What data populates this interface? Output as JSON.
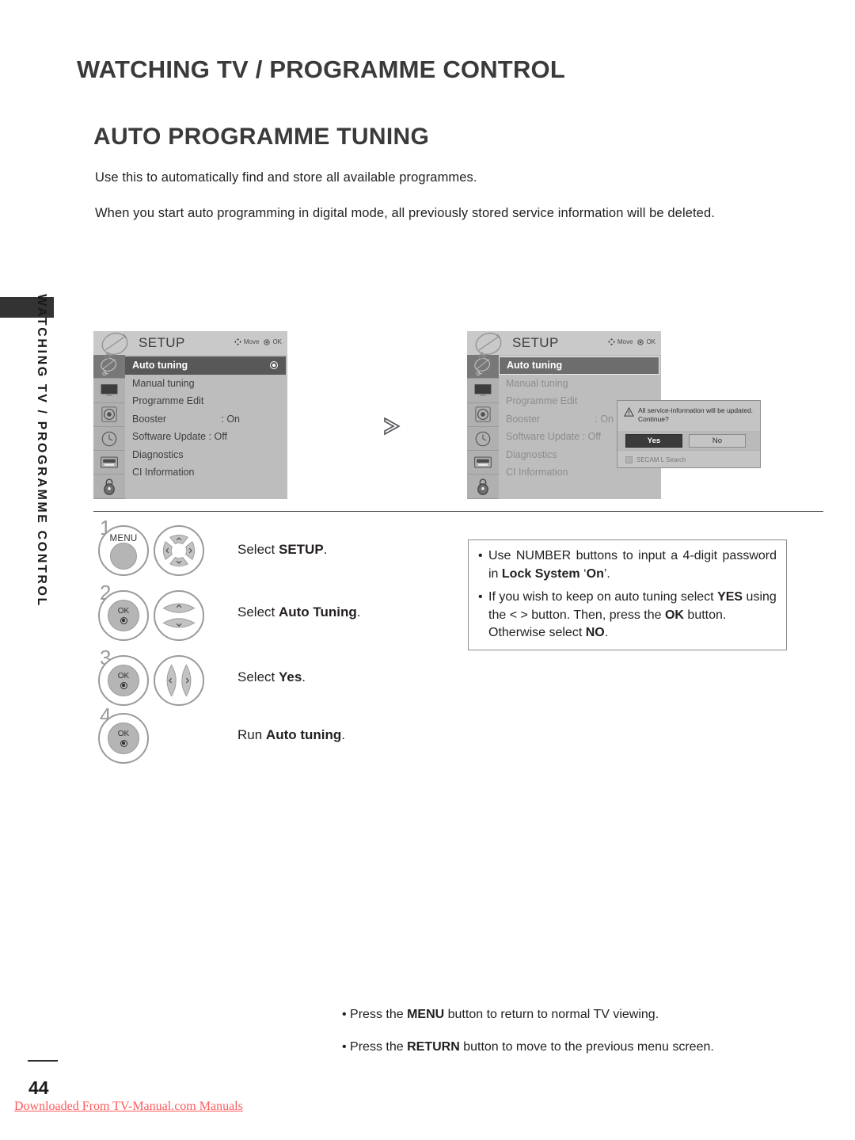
{
  "page": {
    "chapter_title": "WATCHING TV / PROGRAMME CONTROL",
    "section_title": "AUTO PROGRAMME TUNING",
    "intro_paragraphs": [
      "Use this to automatically find and store all available programmes.",
      "When you start auto programming in digital mode, all previously stored service information will be deleted."
    ],
    "side_tab_label": "WATCHING TV / PROGRAMME CONTROL",
    "page_number": "44",
    "download_credit": "Downloaded From TV-Manual.com Manuals"
  },
  "osd": {
    "title": "SETUP",
    "hints": {
      "move": "Move",
      "ok": "OK"
    },
    "rail_icons": [
      "satellite-dish-icon",
      "picture-tv-icon",
      "audio-speaker-icon",
      "clock-time-icon",
      "option-screen-icon",
      "lock-icon"
    ],
    "menu_items": [
      {
        "label": "Auto tuning",
        "value": "",
        "selected": true
      },
      {
        "label": "Manual tuning",
        "value": "",
        "selected": false
      },
      {
        "label": "Programme Edit",
        "value": "",
        "selected": false
      },
      {
        "label": "Booster",
        "value": ": On",
        "selected": false
      },
      {
        "label": "Software Update : Off",
        "value": "",
        "selected": false
      },
      {
        "label": "Diagnostics",
        "value": "",
        "selected": false
      },
      {
        "label": "CI Information",
        "value": "",
        "selected": false
      }
    ]
  },
  "dialog": {
    "message_line_1": "All service-information will be updated.",
    "message_line_2": "Continue?",
    "warning_icon": "warning-triangle-icon",
    "yes_label": "Yes",
    "no_label": "No",
    "secam_label": "SECAM L Search"
  },
  "flow": {
    "arrow_icon": "chevron-right-icon"
  },
  "steps": [
    {
      "num": "1",
      "button": "MENU",
      "nav": "four-way-nav",
      "text_prefix": "Select ",
      "text_bold": "SETUP",
      "text_suffix": "."
    },
    {
      "num": "2",
      "button": "OK",
      "nav": "up-down-nav",
      "text_prefix": "Select ",
      "text_bold": "Auto Tuning",
      "text_suffix": "."
    },
    {
      "num": "3",
      "button": "OK",
      "nav": "left-right-nav",
      "text_prefix": "Select ",
      "text_bold": "Yes",
      "text_suffix": "."
    },
    {
      "num": "4",
      "button": "OK",
      "nav": "",
      "text_prefix": "Run ",
      "text_bold": "Auto tuning",
      "text_suffix": "."
    }
  ],
  "note_box": {
    "items": [
      {
        "bullet": "•",
        "segments": [
          {
            "t": "Use NUMBER buttons to input a 4-digit password in ",
            "b": false
          },
          {
            "t": "Lock System",
            "b": true
          },
          {
            "t": " ‘",
            "b": false
          },
          {
            "t": "On",
            "b": true
          },
          {
            "t": "’.",
            "b": false
          }
        ]
      },
      {
        "bullet": "•",
        "segments": [
          {
            "t": "If you wish to keep on auto tuning select ",
            "b": false
          },
          {
            "t": "YES",
            "b": true
          },
          {
            "t": " using the < > button. Then, press the ",
            "b": false
          },
          {
            "t": "OK",
            "b": true
          },
          {
            "t": " button. Otherwise select ",
            "b": false
          },
          {
            "t": "NO",
            "b": true
          },
          {
            "t": ".",
            "b": false
          }
        ]
      }
    ]
  },
  "footer_notes": [
    {
      "segments": [
        {
          "t": "• Press the ",
          "b": false
        },
        {
          "t": "MENU",
          "b": true
        },
        {
          "t": " button to return to normal TV viewing.",
          "b": false
        }
      ]
    },
    {
      "segments": [
        {
          "t": "• Press the ",
          "b": false
        },
        {
          "t": "RETURN",
          "b": true
        },
        {
          "t": " button to move to the previous menu screen.",
          "b": false
        }
      ]
    }
  ],
  "colors": {
    "heading": "#3a3a3a",
    "body": "#231f20",
    "osd_bg": "#bdbdbd",
    "osd_header": "#c9c9c9",
    "selected_row": "#585858",
    "credit": "#ff5a5a"
  }
}
